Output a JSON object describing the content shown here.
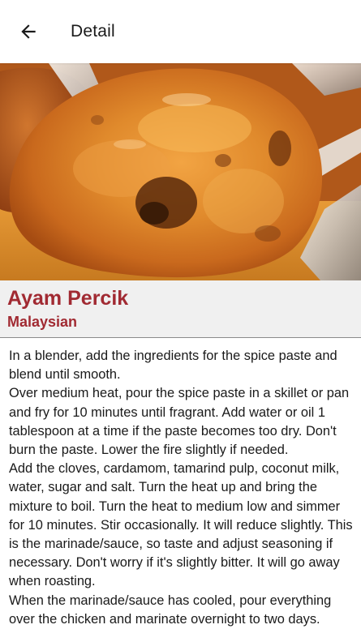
{
  "appbar": {
    "title": "Detail",
    "back_icon": "arrow-left-icon"
  },
  "recipe": {
    "name": "Ayam Percik",
    "cuisine": "Malaysian",
    "image_alt": "Ayam Percik grilled chicken",
    "instructions": "In a blender, add the ingredients for the spice paste and blend until smooth.\nOver medium heat, pour the spice paste in a skillet or pan and fry for 10 minutes until fragrant. Add water or oil 1 tablespoon at a time if the paste becomes too dry. Don't burn the paste. Lower the fire slightly if needed.\nAdd the cloves, cardamom, tamarind pulp, coconut milk, water, sugar and salt. Turn the heat up and bring the mixture to boil. Turn the heat to medium low and simmer for 10 minutes. Stir occasionally. It will reduce slightly. This is the marinade/sauce, so taste and adjust seasoning if necessary. Don't worry if it's slightly bitter. It will go away when roasting.\nWhen the marinade/sauce has cooled, pour everything over the chicken and marinate overnight to two days."
  },
  "colors": {
    "accent": "#a12a32",
    "appbar_bg": "#ffffff",
    "info_bg": "#f0f0f0"
  }
}
